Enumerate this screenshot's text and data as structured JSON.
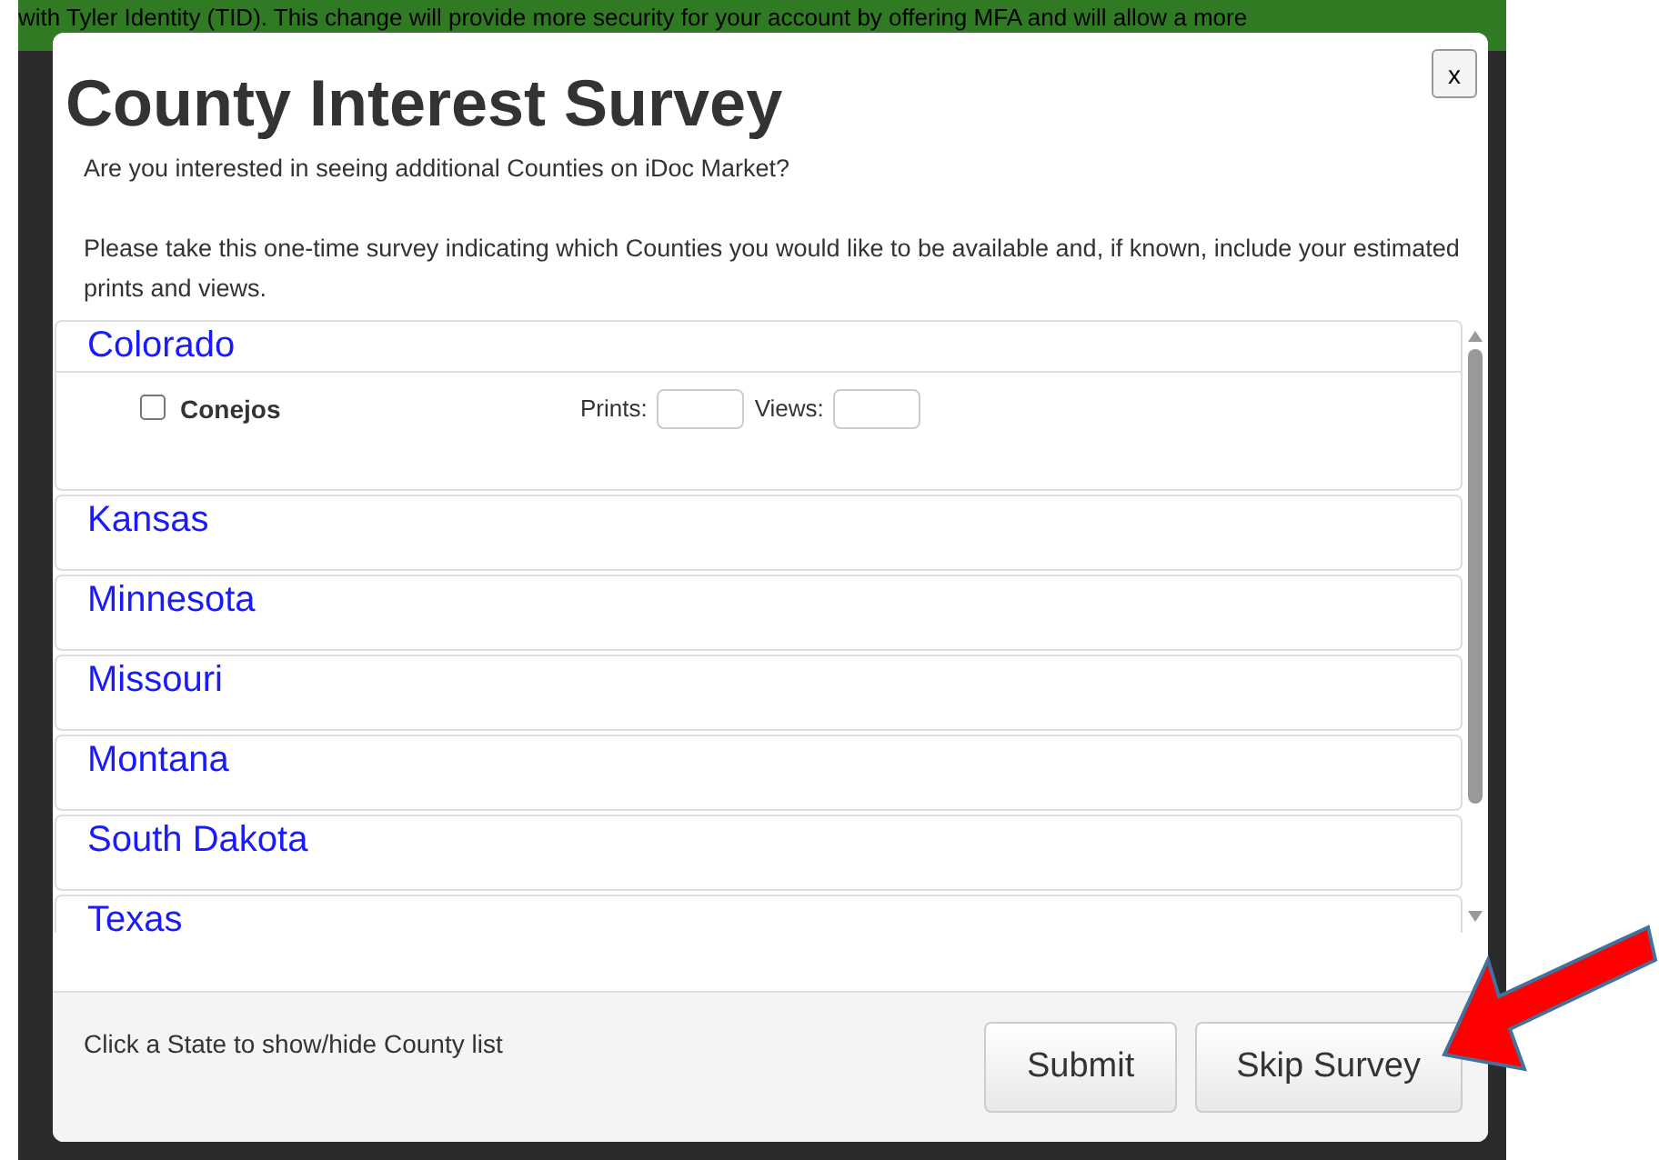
{
  "backdrop": {
    "banner": "with Tyler Identity (TID). This change will provide more security for your account by offering MFA and will allow a more"
  },
  "dialog": {
    "title": "County Interest Survey",
    "close": "x",
    "intro": "Are you interested in seeing additional Counties on iDoc Market?",
    "instructions": "Please take this one-time survey indicating which Counties you would like to be available and, if known, include your estimated prints and views.",
    "states": [
      {
        "name": "Colorado",
        "expanded": true,
        "counties": [
          {
            "name": "Conejos",
            "checked": false,
            "prints_label": "Prints:",
            "views_label": "Views:"
          }
        ]
      },
      {
        "name": "Kansas",
        "expanded": false
      },
      {
        "name": "Minnesota",
        "expanded": false
      },
      {
        "name": "Missouri",
        "expanded": false
      },
      {
        "name": "Montana",
        "expanded": false
      },
      {
        "name": "South Dakota",
        "expanded": false
      },
      {
        "name": "Texas",
        "expanded": false
      }
    ],
    "footer_hint": "Click a State to show/hide County list",
    "buttons": [
      "Submit",
      "Skip Survey"
    ]
  }
}
